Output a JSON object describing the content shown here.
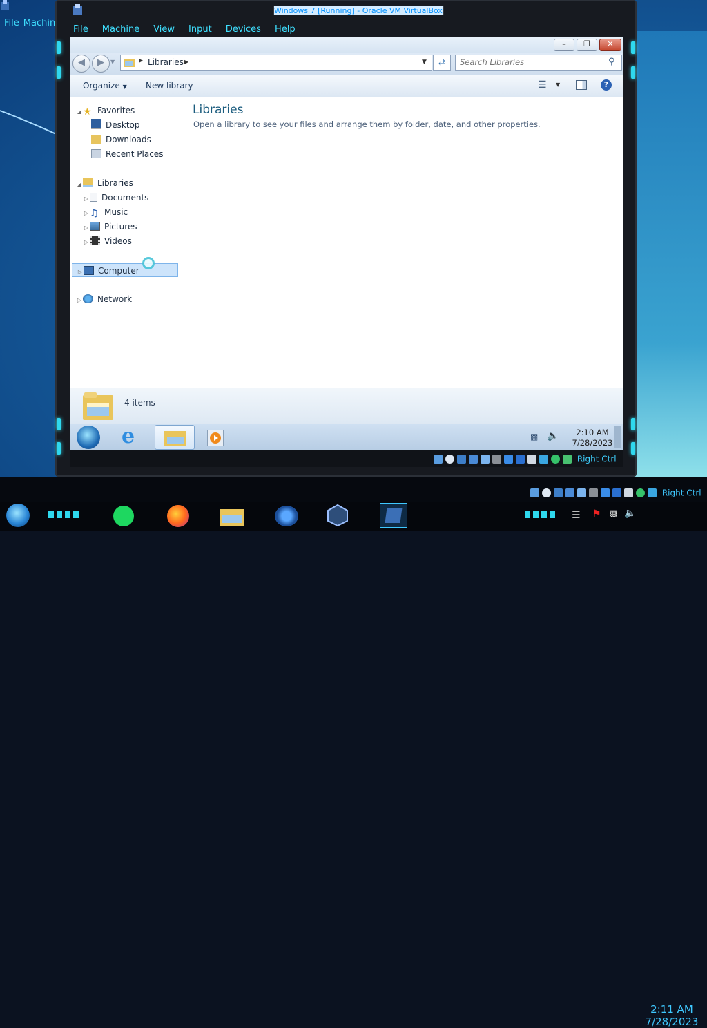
{
  "host": {
    "menu": [
      "File",
      "Machine"
    ],
    "status_key": "Right Ctrl",
    "clock": {
      "time": "2:11 AM",
      "date": "7/28/2023"
    }
  },
  "vm": {
    "title": "Windows 7 [Running] - Oracle VM VirtualBox",
    "menu": [
      "File",
      "Machine",
      "View",
      "Input",
      "Devices",
      "Help"
    ],
    "status_key": "Right Ctrl"
  },
  "explorer": {
    "address": {
      "crumb": "Libraries"
    },
    "search": {
      "placeholder": "Search Libraries"
    },
    "commands": {
      "organize": "Organize",
      "new_library": "New library"
    },
    "nav": {
      "favorites": {
        "label": "Favorites",
        "items": [
          "Desktop",
          "Downloads",
          "Recent Places"
        ]
      },
      "libraries": {
        "label": "Libraries",
        "items": [
          "Documents",
          "Music",
          "Pictures",
          "Videos"
        ]
      },
      "computer": "Computer",
      "network": "Network"
    },
    "content": {
      "title": "Libraries",
      "subtitle": "Open a library to see your files and arrange them by folder, date, and other properties."
    },
    "details": {
      "count": "4 items"
    }
  },
  "guest_taskbar": {
    "clock": {
      "time": "2:10 AM",
      "date": "7/28/2023"
    }
  },
  "colors": {
    "accent": "#2fd8ee",
    "nav_selected": "#cde4fb",
    "library_title": "#1b5c7e"
  }
}
